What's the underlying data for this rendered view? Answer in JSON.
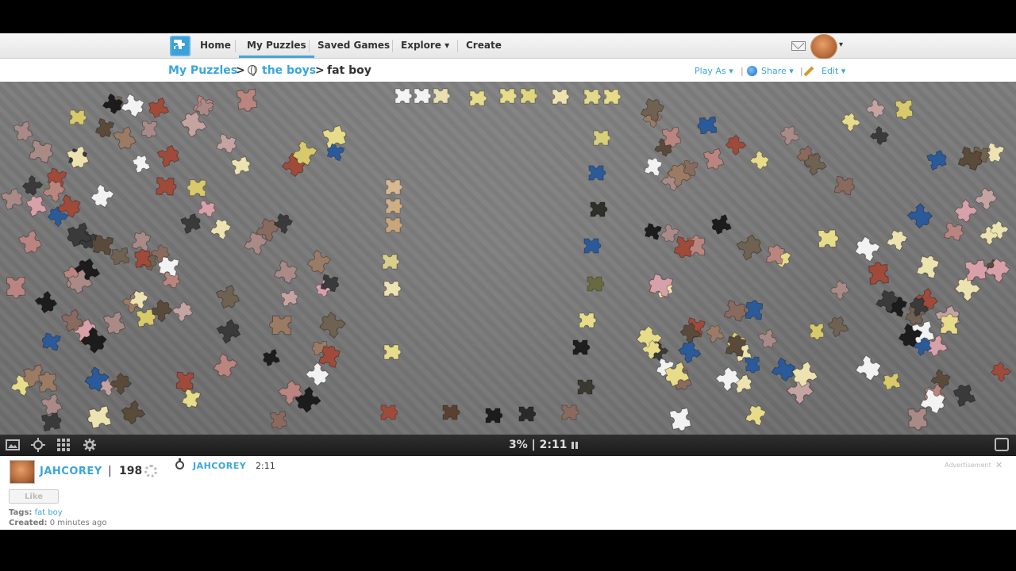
{
  "nav": {
    "items": [
      {
        "label": "Home"
      },
      {
        "label": "My Puzzles"
      },
      {
        "label": "Saved Games"
      },
      {
        "label": "Explore ▾"
      },
      {
        "label": "Create"
      }
    ],
    "active_index": 1,
    "avatar_caret": "▾"
  },
  "breadcrumb": {
    "my_puzzles": "My Puzzles",
    "sep": ">",
    "folder": "the boys",
    "puzzle": "fat boy"
  },
  "actions": {
    "play_as": "Play As ▾",
    "sep": "|",
    "share": "Share ▾",
    "edit": "Edit ▾"
  },
  "controls": {
    "progress": "3%",
    "divider": "|",
    "time": "2:11"
  },
  "info": {
    "username": "JAHCOREY",
    "pipe": "|",
    "score": "198",
    "timer_username": "JAHCOREY",
    "timer_time": "2:11",
    "advertisement": "Advertisement",
    "ad_close": "✕",
    "like_label": "Like",
    "tags_label": "Tags:",
    "tags_value": "fat boy",
    "created_label": "Created:",
    "created_value": "0 minutes ago"
  },
  "colors": {
    "accent": "#3aa7d9",
    "board": "#747474",
    "control_bar": "#222222"
  }
}
